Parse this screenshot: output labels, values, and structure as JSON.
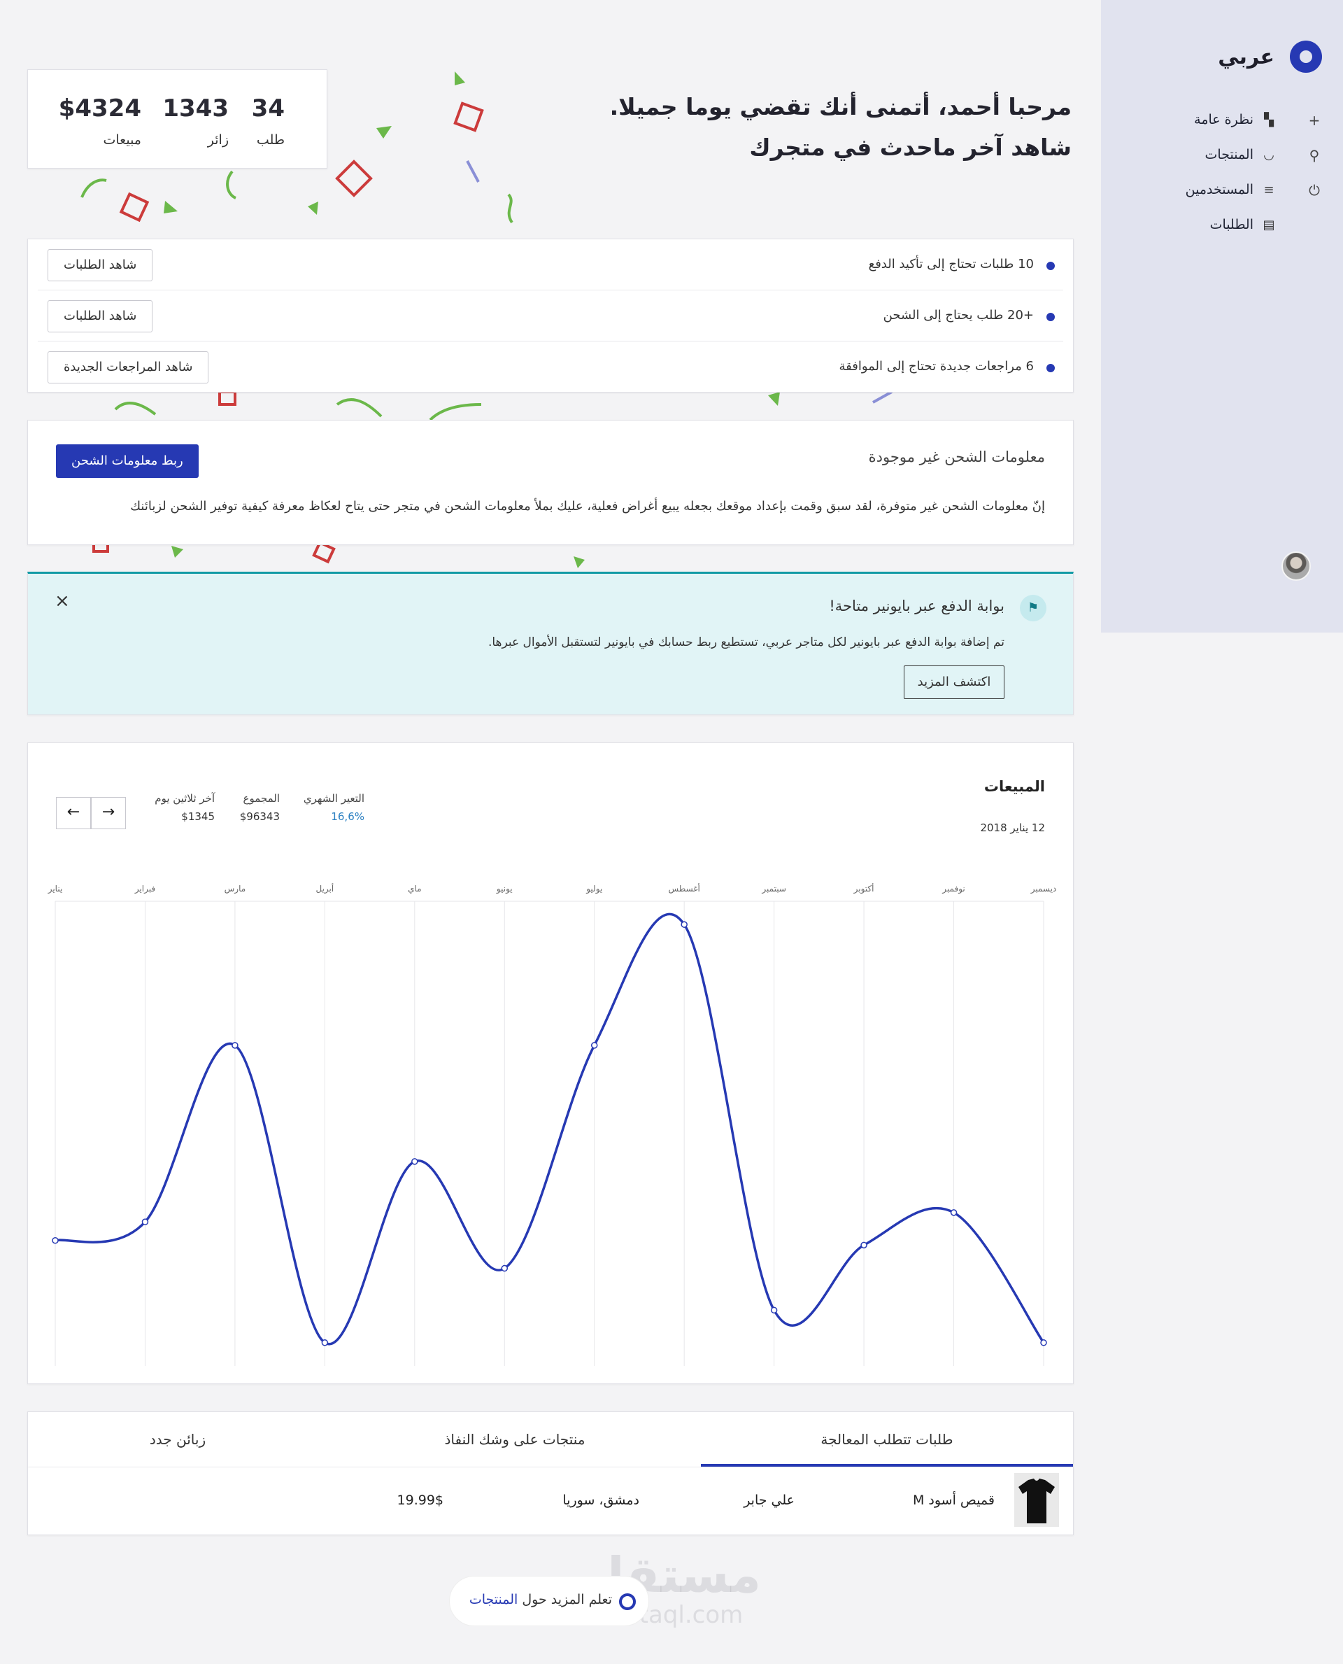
{
  "brand": {
    "name": "عربي"
  },
  "sidebar": {
    "items": [
      {
        "label": "نظرة عامة",
        "icon": "dashboard-icon",
        "side_icon": "plus-icon"
      },
      {
        "label": "المنتجات",
        "icon": "basket-icon",
        "side_icon": "search-icon"
      },
      {
        "label": "المستخدمين",
        "icon": "sliders-icon",
        "side_icon": "power-icon"
      },
      {
        "label": "الطلبات",
        "icon": "document-icon",
        "side_icon": ""
      }
    ]
  },
  "greeting": {
    "line1": "مرحبا أحمد، أتمنى أنك تقضي يوما جميلا.",
    "line2": "شاهد آخر ماحدث في متجرك"
  },
  "stats": [
    {
      "value": "34",
      "label": "طلب"
    },
    {
      "value": "1343",
      "label": "زائر"
    },
    {
      "value": "$4324",
      "label": "مبيعات"
    }
  ],
  "tasks": [
    {
      "text": "10 طلبات تحتاج إلى تأكيد الدفع",
      "button": "شاهد الطلبات"
    },
    {
      "text": "+20 طلب يحتاج إلى الشحن",
      "button": "شاهد الطلبات"
    },
    {
      "text": "6 مراجعات جديدة تحتاج إلى الموافقة",
      "button": "شاهد المراجعات الجديدة"
    }
  ],
  "shipping": {
    "title": "معلومات الشحن غير موجودة",
    "description": "إنّ معلومات الشحن غير متوفرة، لقد سبق وقمت بإعداد موقعك بجعله يبيع أغراض فعلية، عليك بملأ معلومات الشحن في متجر حتى يتاح لعكاظ معرفة كيفية توفير الشحن لزبائنك",
    "button": "ربط معلومات الشحن"
  },
  "alert": {
    "title": "بوابة الدفع عبر بايونير متاحة!",
    "text": "تم إضافة بوابة الدفع عبر بايونير لكل متاجر عربي، تستطيع ربط حسابك في بايونير لتستقبل الأموال عبرها.",
    "button": "اكتشف المزيد",
    "close": "×"
  },
  "sales": {
    "title": "المبيعات",
    "date": "12 يناير 2018",
    "stats": [
      {
        "label": "التعير الشهري",
        "value": "16,6%"
      },
      {
        "label": "المجموع",
        "value": "$96343"
      },
      {
        "label": "آخر ثلاثين يوم",
        "value": "$1345"
      }
    ],
    "prev": "←",
    "next": "→"
  },
  "chart_data": {
    "type": "line",
    "categories": [
      "يناير",
      "فبراير",
      "مارس",
      "أبريل",
      "ماي",
      "يونيو",
      "يوليو",
      "أغسطس",
      "سبتمبر",
      "أكتوبر",
      "نوفمبر",
      "ديسمبر"
    ],
    "values": [
      27,
      31,
      69,
      5,
      44,
      21,
      69,
      95,
      12,
      26,
      33,
      5
    ],
    "ylim": [
      0,
      100
    ],
    "grid": true,
    "color": "#2639b3"
  },
  "tabs": [
    {
      "label": "طلبات تتطلب المعالجة",
      "active": true
    },
    {
      "label": "منتجات على وشك النفاذ",
      "active": false
    },
    {
      "label": "زبائن جدد",
      "active": false
    }
  ],
  "order_row": {
    "product": "قميص أسود M",
    "customer": "علي جابر",
    "location": "دمشق، سوريا",
    "price": "19.99$"
  },
  "learn_more": {
    "prefix": "تعلم المزيد حول",
    "link": "المنتجات"
  },
  "watermark": {
    "text": "مستقل",
    "sub": "mostaql.com"
  },
  "colors": {
    "accent": "#2639b3",
    "sidebar": "#e1e3ef",
    "alert": "#e1f4f6",
    "alert_border": "#119aa5"
  }
}
